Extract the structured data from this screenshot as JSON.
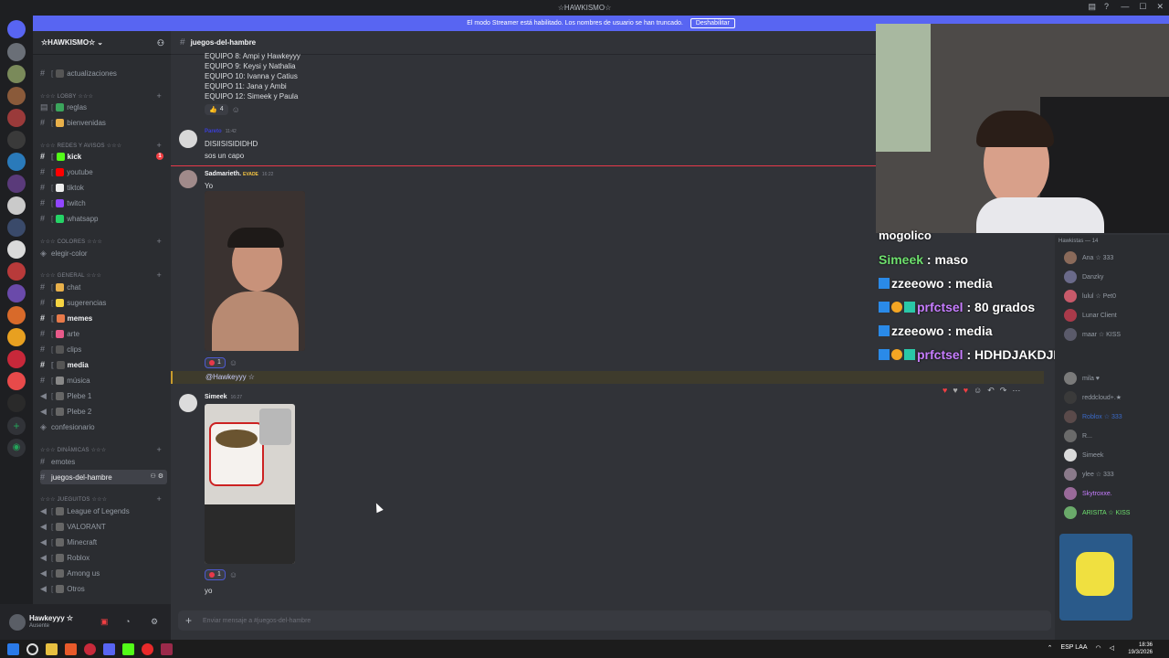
{
  "window": {
    "title": "☆HAWKISMO☆",
    "controls": [
      "—",
      "☐",
      "✕"
    ]
  },
  "streamer_banner": {
    "text": "El modo Streamer está habilitado. Los nombres de usuario se han truncado.",
    "button": "Deshabilitar"
  },
  "guild": {
    "name": "☆HAWKISMO☆"
  },
  "sidebar": {
    "channels": [
      {
        "label": "actualizaciones",
        "prefix": "[",
        "kind": "text"
      },
      {
        "category": "☆☆☆ LOBBY ☆☆☆"
      },
      {
        "label": "reglas",
        "kind": "text"
      },
      {
        "label": "bienvenidas",
        "kind": "text"
      },
      {
        "category": "☆☆☆ REDES Y AVISOS ☆☆☆"
      },
      {
        "label": "kick",
        "kind": "text",
        "bold": true,
        "badge": "1"
      },
      {
        "label": "youtube",
        "kind": "text"
      },
      {
        "label": "tiktok",
        "kind": "text"
      },
      {
        "label": "twitch",
        "kind": "text"
      },
      {
        "label": "whatsapp",
        "kind": "text"
      },
      {
        "category": "☆☆☆ COLORES ☆☆☆"
      },
      {
        "label": "elegir-color",
        "kind": "text"
      },
      {
        "category": "☆☆☆ GENERAL ☆☆☆"
      },
      {
        "label": "chat",
        "kind": "text"
      },
      {
        "label": "sugerencias",
        "kind": "text"
      },
      {
        "label": "memes",
        "kind": "text",
        "bold": true
      },
      {
        "label": "arte",
        "kind": "text"
      },
      {
        "label": "clips",
        "kind": "text"
      },
      {
        "label": "media",
        "kind": "text",
        "bold": true
      },
      {
        "label": "música",
        "kind": "text"
      },
      {
        "label": "Plebe 1",
        "kind": "voice"
      },
      {
        "label": "Plebe 2",
        "kind": "voice"
      },
      {
        "label": "confesionario",
        "kind": "text"
      },
      {
        "category": "☆☆☆ DINÁMICAS ☆☆☆"
      },
      {
        "label": "emotes",
        "kind": "text"
      },
      {
        "label": "juegos-del-hambre",
        "kind": "text",
        "selected": true
      },
      {
        "category": "☆☆☆ JUEGUITOS ☆☆☆"
      },
      {
        "label": "League of Legends",
        "kind": "voice"
      },
      {
        "label": "VALORANT",
        "kind": "voice"
      },
      {
        "label": "Minecraft",
        "kind": "voice"
      },
      {
        "label": "Roblox",
        "kind": "voice"
      },
      {
        "label": "Among us",
        "kind": "voice"
      },
      {
        "label": "Otros",
        "kind": "voice"
      }
    ]
  },
  "user": {
    "name": "Hawkeyyy ☆",
    "status": "Ausente"
  },
  "chat": {
    "channel": "juegos-del-hambre",
    "top_lines": [
      "EQUIPO 8: Ampi y Hawkeyyy",
      "EQUIPO 9: Keysi y Nathalia",
      "EQUIPO 10: Ivanna y Catius",
      "EQUIPO 11: Jana y Ambi",
      "EQUIPO 12: Simeek y Paula"
    ],
    "reaction1": {
      "emoji": "👍",
      "count": "4"
    },
    "msg1": {
      "author": "Pareto",
      "time": "11:42",
      "lines": [
        "DISIISISIDIDHD",
        "sos un capo"
      ]
    },
    "msg2": {
      "author": "Sadmarieth.",
      "tag": "EVADE",
      "time": "16:22",
      "text": "Yo",
      "reaction_count": "1"
    },
    "mention": "@Hawkeyyy ☆",
    "msg3": {
      "author": "Simeek",
      "time": "16:27",
      "text": "yo",
      "reaction_count": "1"
    },
    "composer_placeholder": "Enviar mensaje a #juegos-del-hambre"
  },
  "overlay": {
    "lines": [
      {
        "user": "mogolico",
        "msg": "",
        "color": "#ffffff"
      },
      {
        "user": "Simeek",
        "msg": "maso",
        "color": "#6ee06e"
      },
      {
        "user": "zzeeowo",
        "msg": "media",
        "color": "#ffffff"
      },
      {
        "user": "prfctsel",
        "msg": "80 grados",
        "color": "#c77dff"
      },
      {
        "user": "zzeeowo",
        "msg": "media",
        "color": "#ffffff"
      },
      {
        "user": "prfctsel",
        "msg": "HDHDJAKDJHDDJSJD",
        "color": "#c77dff"
      }
    ]
  },
  "members": {
    "header": "Hawkistas — 14",
    "list": [
      "Ana ☆ 333",
      "Danzky",
      "lulul ☆ Pet0",
      "Lunar Client",
      "maar ☆ KISS",
      "mila ♥",
      "reddcloud+.★",
      "Roblox ☆ 333",
      "R...",
      "Simeek",
      "ylee ☆ 333",
      "Skytroxxe.",
      "ARISITA ☆ KISS"
    ]
  },
  "taskbar": {
    "lang": "ESP LAA",
    "time": "18:36",
    "date": "19/3/2026"
  },
  "colors": {
    "accent": "#5865f2",
    "new_messages_line": "#e8394a",
    "mention_bg": "#3e3b2c"
  }
}
